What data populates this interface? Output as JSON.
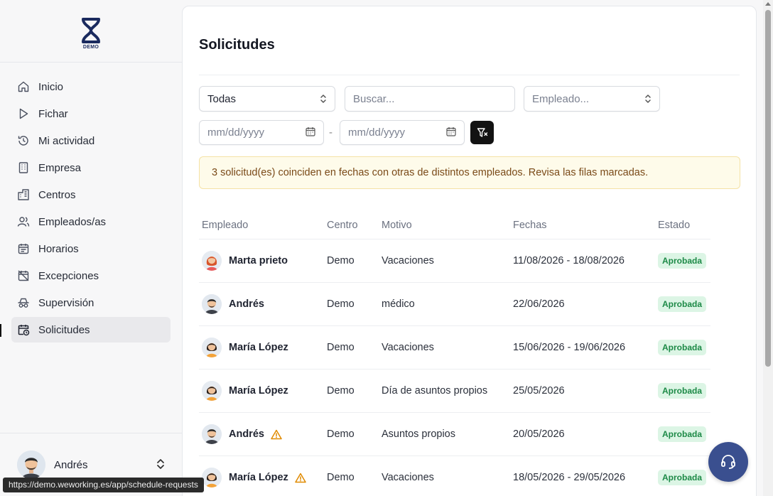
{
  "logo": {
    "text": "DEMO"
  },
  "sidebar": {
    "items": [
      {
        "label": "Inicio",
        "icon": "home-icon"
      },
      {
        "label": "Fichar",
        "icon": "play-icon"
      },
      {
        "label": "Mi actividad",
        "icon": "history-icon"
      },
      {
        "label": "Empresa",
        "icon": "building-icon"
      },
      {
        "label": "Centros",
        "icon": "office-icon"
      },
      {
        "label": "Empleados/as",
        "icon": "users-icon"
      },
      {
        "label": "Horarios",
        "icon": "calendar-icon"
      },
      {
        "label": "Excepciones",
        "icon": "calendar-off-icon"
      },
      {
        "label": "Supervisión",
        "icon": "incognito-icon"
      },
      {
        "label": "Solicitudes",
        "icon": "calendar-clock-icon",
        "active": true
      }
    ],
    "user": {
      "name": "Andrés"
    }
  },
  "page": {
    "title": "Solicitudes"
  },
  "filters": {
    "status_select": "Todas",
    "search_placeholder": "Buscar...",
    "employee_placeholder": "Empleado...",
    "date_from_placeholder": "mm/dd/yyyy",
    "date_to_placeholder": "mm/dd/yyyy",
    "date_separator": "-"
  },
  "alert": {
    "text": "3 solicitud(es) coinciden en fechas con otras de distintos empleados. Revisa las filas marcadas."
  },
  "table": {
    "headers": {
      "empleado": "Empleado",
      "centro": "Centro",
      "motivo": "Motivo",
      "fechas": "Fechas",
      "estado": "Estado"
    },
    "rows": [
      {
        "empleado": "Marta prieto",
        "centro": "Demo",
        "motivo": "Vacaciones",
        "fechas": "11/08/2026 - 18/08/2026",
        "estado": "Aprobada",
        "warning": false,
        "avatar": "woman-red"
      },
      {
        "empleado": "Andrés",
        "centro": "Demo",
        "motivo": "médico",
        "fechas": "22/06/2026",
        "estado": "Aprobada",
        "warning": false,
        "avatar": "man"
      },
      {
        "empleado": "María López",
        "centro": "Demo",
        "motivo": "Vacaciones",
        "fechas": "15/06/2026 - 19/06/2026",
        "estado": "Aprobada",
        "warning": false,
        "avatar": "woman-dark"
      },
      {
        "empleado": "María López",
        "centro": "Demo",
        "motivo": "Día de asuntos propios",
        "fechas": "25/05/2026",
        "estado": "Aprobada",
        "warning": false,
        "avatar": "woman-dark"
      },
      {
        "empleado": "Andrés",
        "centro": "Demo",
        "motivo": "Asuntos propios",
        "fechas": "20/05/2026",
        "estado": "Aprobada",
        "warning": true,
        "avatar": "man"
      },
      {
        "empleado": "María López",
        "centro": "Demo",
        "motivo": "Vacaciones",
        "fechas": "18/05/2026 - 29/05/2026",
        "estado": "Aprobada",
        "warning": true,
        "avatar": "woman-dark"
      }
    ]
  },
  "status_bar": {
    "url": "https://demo.weworking.es/app/schedule-requests"
  },
  "colors": {
    "brand": "#1a2a5e",
    "badge_bg": "#dcf5e5",
    "badge_text": "#1d8a47",
    "warning": "#e08a00",
    "support": "#3a4f8f"
  }
}
